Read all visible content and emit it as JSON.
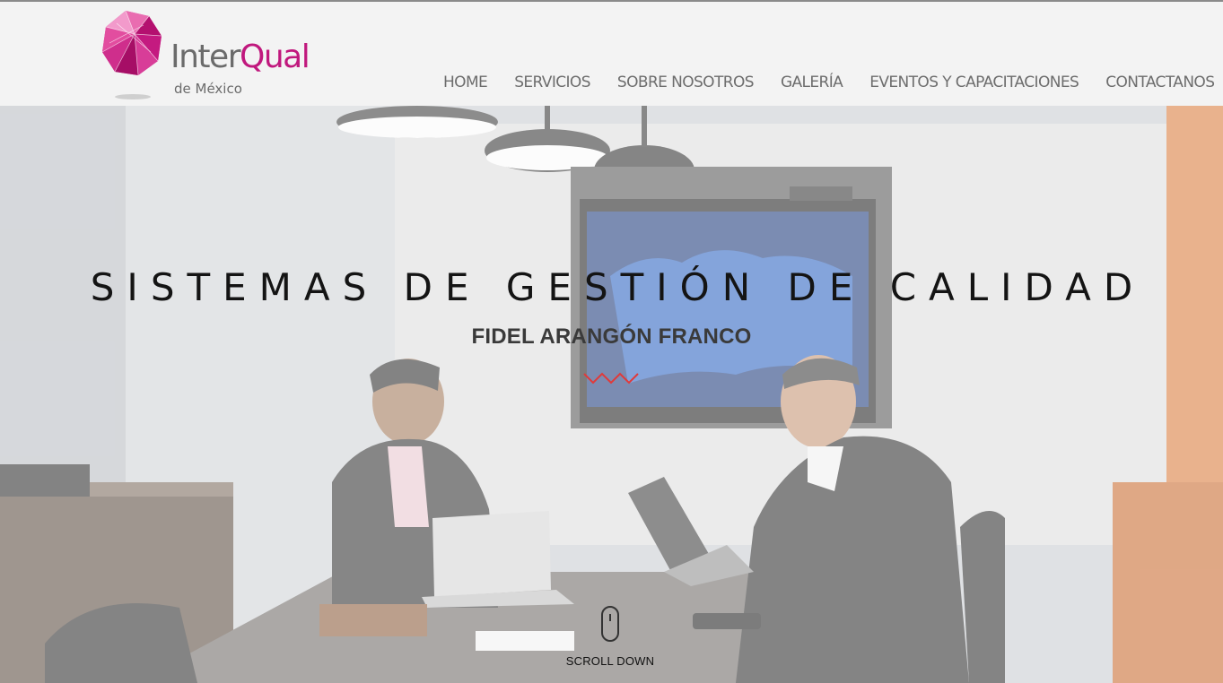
{
  "brand": {
    "name_part1": "Inter",
    "name_part2": "Qual",
    "subtitle": "de México",
    "primary_color": "#c0187d",
    "gray_color": "#6b6b6b"
  },
  "nav": {
    "items": [
      {
        "label": "HOME"
      },
      {
        "label": "SERVICIOS"
      },
      {
        "label": "SOBRE NOSOTROS"
      },
      {
        "label": "GALERÍA"
      },
      {
        "label": "EVENTOS Y CAPACITACIONES"
      },
      {
        "label": "CONTACTANOS"
      }
    ]
  },
  "hero": {
    "title": "SISTEMAS DE GESTIÓN DE CALIDAD",
    "subtitle": "FIDEL ARANGÓN FRANCO",
    "accent_color": "#e03a3a",
    "scroll_label": "SCROLL DOWN"
  }
}
